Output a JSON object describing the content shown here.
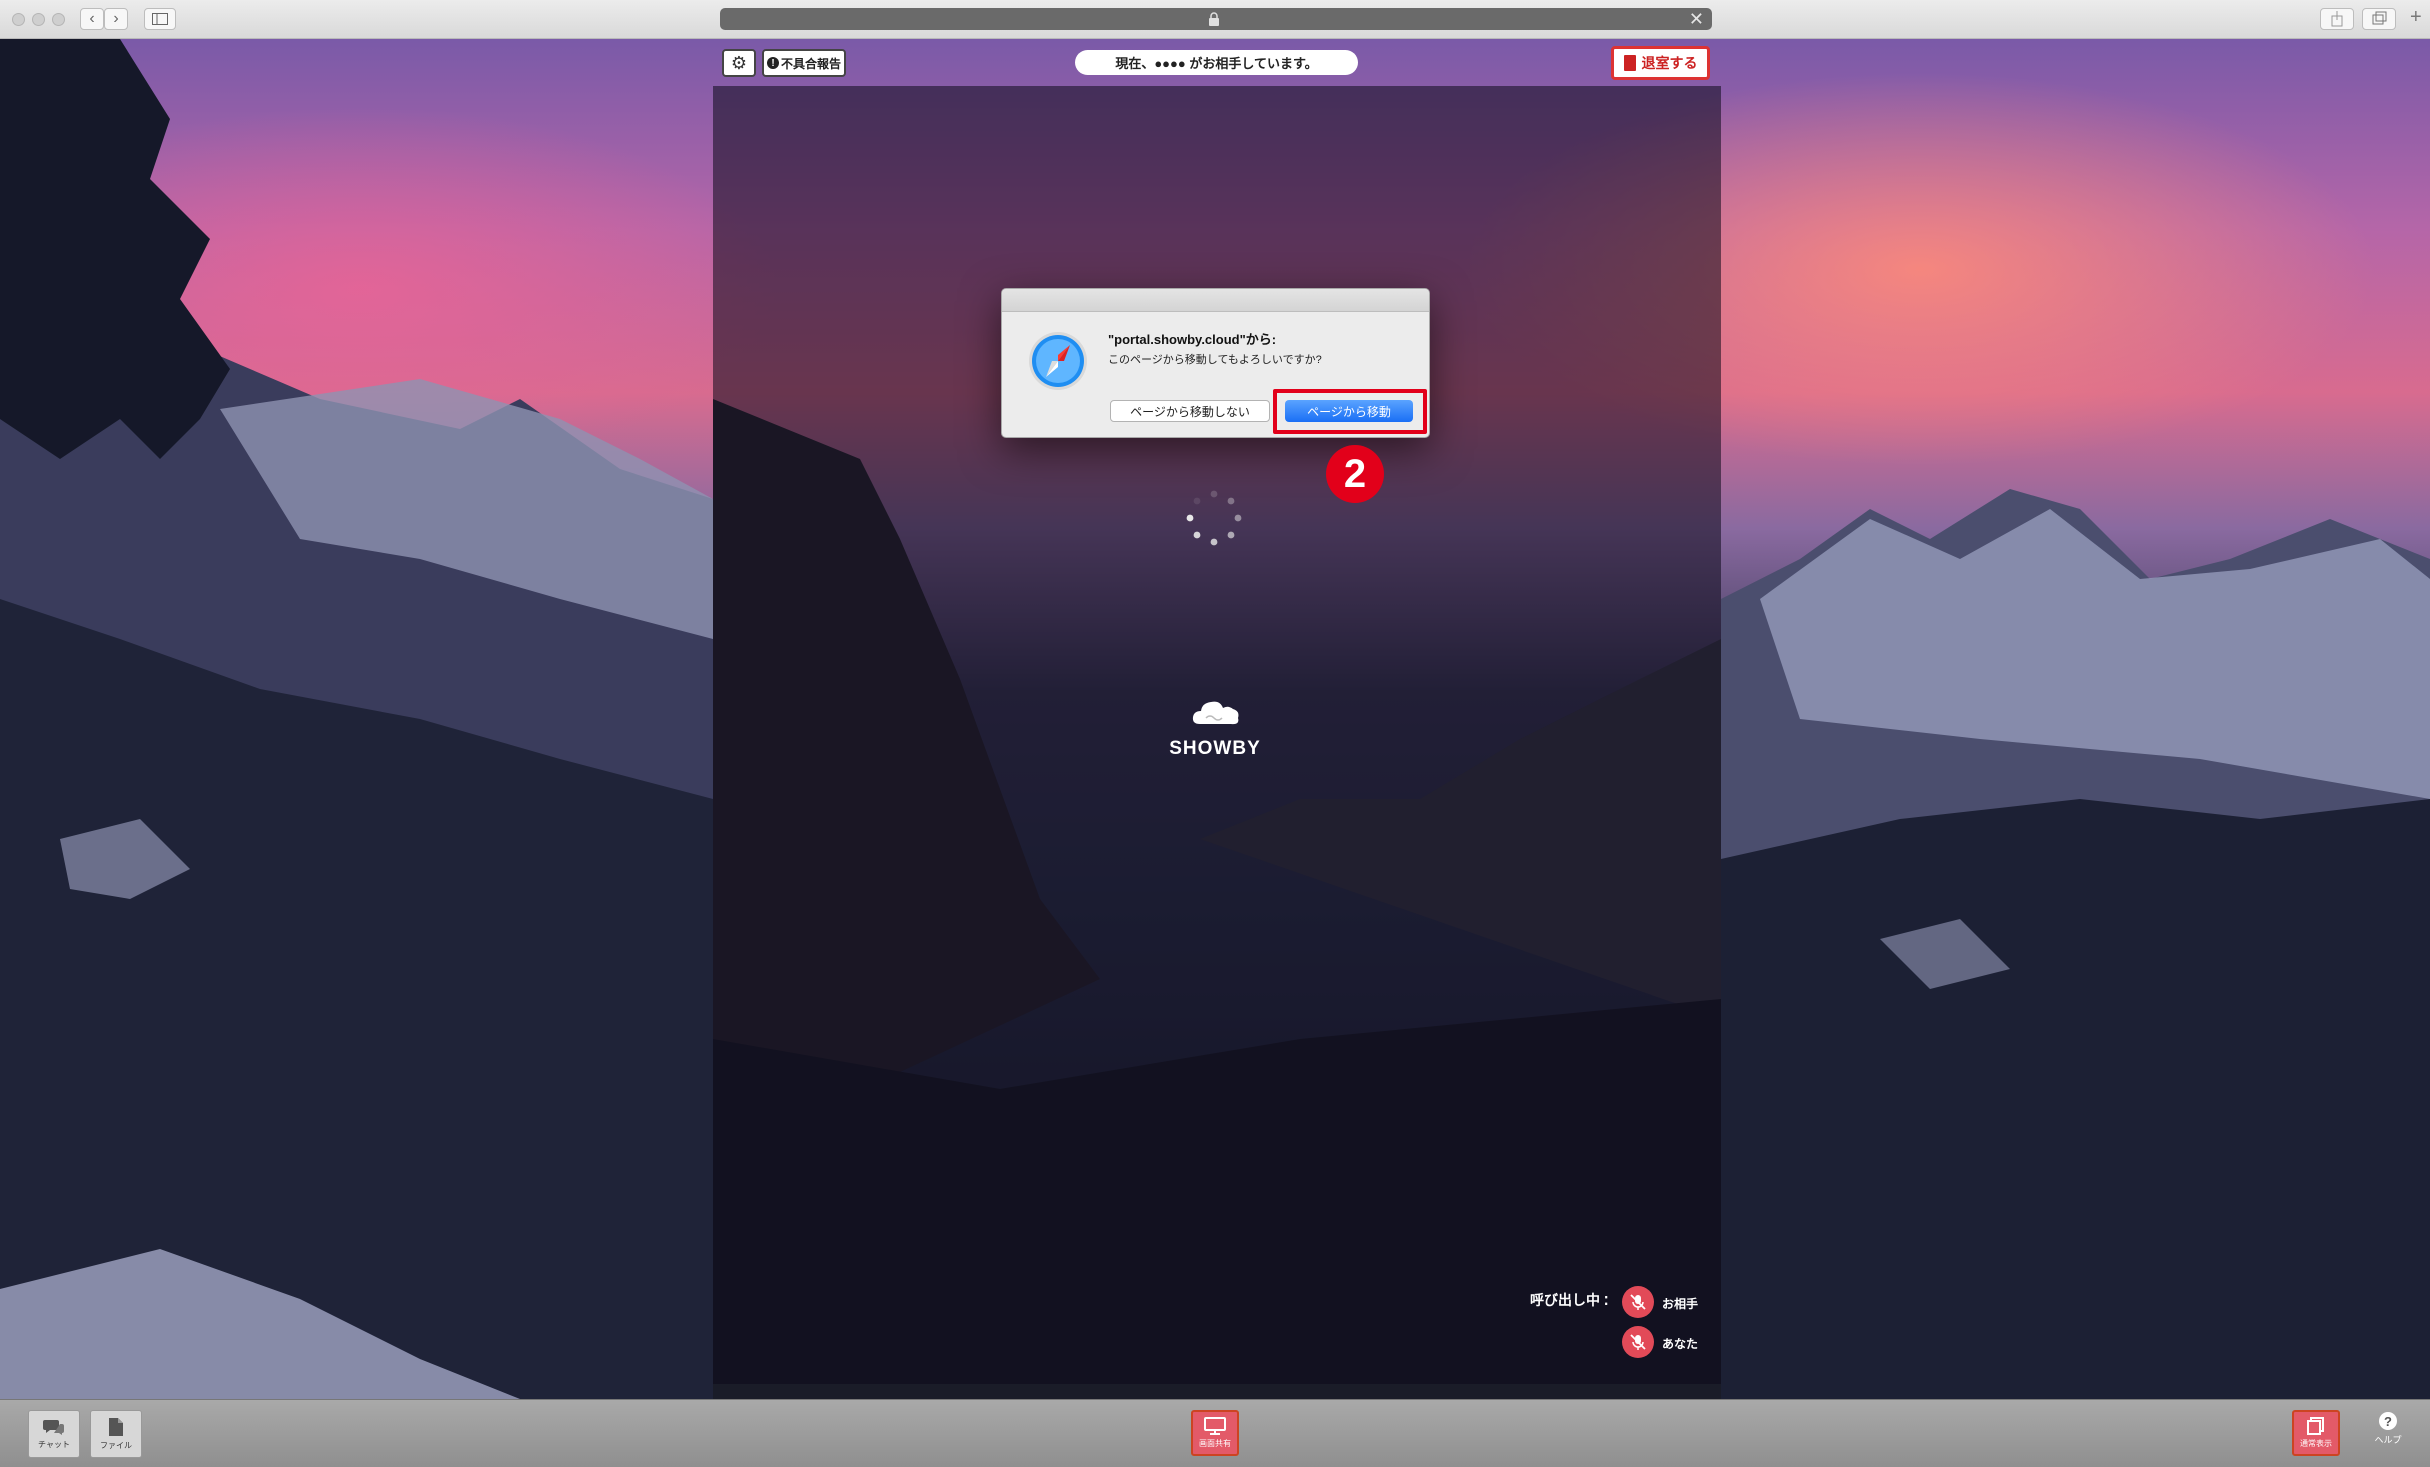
{
  "browser": {
    "tab_plus": "+"
  },
  "session": {
    "status_text": "現在、●●●● がお相手しています。",
    "report_label": "不具合報告",
    "leave_label": "退室する"
  },
  "dialog": {
    "title": "\"portal.showby.cloud\"から:",
    "message": "このページから移動してもよろしいですか?",
    "stay_label": "ページから移動しない",
    "leave_label": "ページから移動"
  },
  "annotation": {
    "step_number": "2"
  },
  "logo": {
    "text": "SHOWBY"
  },
  "call_status": {
    "calling_text": "呼び出し中",
    "partner_label": "お相手",
    "self_label": "あなた"
  },
  "toolbar": {
    "chat_label": "チャット",
    "file_label": "ファイル",
    "screen_share_label": "画面共有",
    "display_label": "通常表示",
    "help_label": "ヘルプ"
  },
  "colors": {
    "accent_red": "#e2001a",
    "dialog_primary_blue": "#1a6ff5",
    "mic_off_red": "#e24a58"
  }
}
